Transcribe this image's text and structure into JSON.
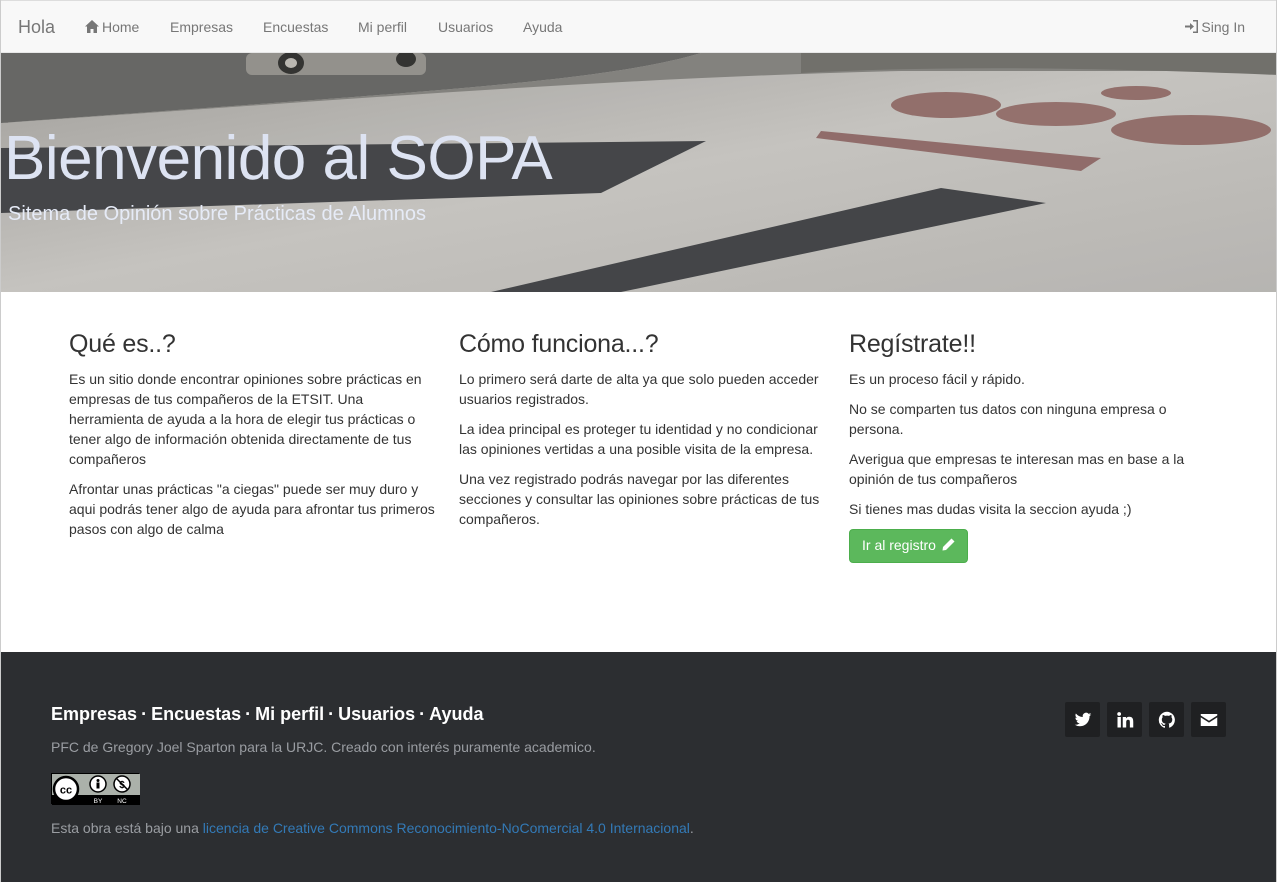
{
  "navbar": {
    "brand": "Hola",
    "items": [
      {
        "label": "Home",
        "icon": "home-icon"
      },
      {
        "label": "Empresas"
      },
      {
        "label": "Encuestas"
      },
      {
        "label": "Mi perfil"
      },
      {
        "label": "Usuarios"
      },
      {
        "label": "Ayuda"
      }
    ],
    "signin": {
      "label": "Sing In",
      "icon": "log-in-icon"
    }
  },
  "hero": {
    "title": "Bienvenido al SOPA",
    "subtitle": "Sitema de Opinión sobre Prácticas de Alumnos"
  },
  "columns": [
    {
      "title": "Qué es..?",
      "paragraphs": [
        "Es un sitio donde encontrar opiniones sobre prácticas en empresas de tus compañeros de la ETSIT. Una herramienta de ayuda a la hora de elegir tus prácticas o tener algo de información obtenida directamente de tus compañeros",
        "Afrontar unas prácticas \"a ciegas\" puede ser muy duro y aqui podrás tener algo de ayuda para afrontar tus primeros pasos con algo de calma"
      ]
    },
    {
      "title": "Cómo funciona...?",
      "paragraphs": [
        "Lo primero será darte de alta ya que solo pueden acceder usuarios registrados.",
        "La idea principal es proteger tu identidad y no condicionar las opiniones vertidas a una posible visita de la empresa.",
        "Una vez registrado podrás navegar por las diferentes secciones y consultar las opiniones sobre prácticas de tus compañeros."
      ]
    },
    {
      "title": "Regístrate!!",
      "paragraphs": [
        "Es un proceso fácil y rápido.",
        "No se comparten tus datos con ninguna empresa o persona.",
        "Averigua que empresas te interesan mas en base a la opinión de tus compañeros",
        "Si tienes mas dudas visita la seccion ayuda ;)"
      ],
      "button": {
        "label": "Ir al registro",
        "icon": "pencil-icon",
        "color": "#5cb85c"
      }
    }
  ],
  "footer": {
    "links": [
      "Empresas",
      "Encuestas",
      "Mi perfil",
      "Usuarios",
      "Ayuda"
    ],
    "separator": "·",
    "credit": "PFC de Gregory Joel Sparton para la URJC. Creado con interés puramente academico.",
    "cc_badge": {
      "icon": "cc-by-nc-icon",
      "labels": [
        "BY",
        "NC"
      ]
    },
    "license_prefix": "Esta obra está bajo una ",
    "license_link": "licencia de Creative Commons Reconocimiento-NoComercial 4.0 Internacional",
    "license_suffix": ".",
    "social": [
      "twitter-icon",
      "linkedin-icon",
      "github-icon",
      "envelope-icon"
    ],
    "bg_color": "#2c2e31"
  }
}
